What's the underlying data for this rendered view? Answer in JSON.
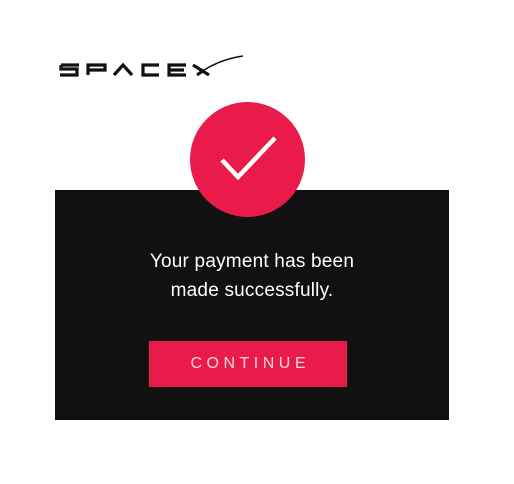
{
  "brand": {
    "name": "SPACEX"
  },
  "status": {
    "icon": "checkmark-icon",
    "accent_color": "#ea1a4b",
    "message_line1": "Your payment has been",
    "message_line2": "made successfully."
  },
  "actions": {
    "continue_label": "CONTINUE"
  },
  "colors": {
    "card_background": "#111111",
    "page_background": "#ffffff",
    "accent": "#ea1a4b"
  }
}
